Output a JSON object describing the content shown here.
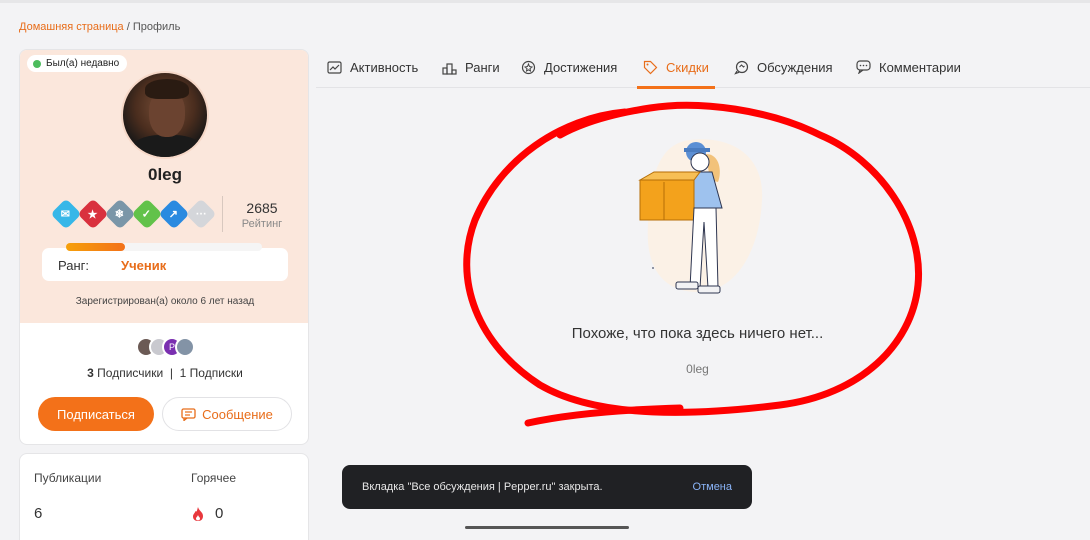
{
  "breadcrumb": {
    "home": "Домашняя страница",
    "separator": " / ",
    "current": "Профиль"
  },
  "profile": {
    "status": "Был(а) недавно",
    "username": "0leg",
    "rating_value": "2685",
    "rating_label": "Рейтинг",
    "rank_label": "Ранг:",
    "rank_value": "Ученик",
    "rank_progress": 0.3,
    "registered": "Зарегистрирован(а) около 6 лет назад",
    "followers_count": "3",
    "followers_label": "Подписчики",
    "following_sep": "|",
    "following_count": "1",
    "following_label": "Подписки",
    "subscribe_label": "Подписаться",
    "message_label": "Сообщение",
    "badges": [
      "chat-badge-icon",
      "ribbon-badge-icon",
      "snowflake-badge-icon",
      "check-badge-icon",
      "rocket-badge-icon",
      "more-badge-icon"
    ]
  },
  "stats": {
    "posts_label": "Публикации",
    "posts_value": "6",
    "hot_label": "Горячее",
    "hot_value": "0"
  },
  "tabs": [
    {
      "label": "Активность",
      "icon": "activity-icon"
    },
    {
      "label": "Ранги",
      "icon": "podium-icon"
    },
    {
      "label": "Достижения",
      "icon": "achievement-icon"
    },
    {
      "label": "Скидки",
      "icon": "tag-icon",
      "active": true
    },
    {
      "label": "Обсуждения",
      "icon": "discussion-icon"
    },
    {
      "label": "Комментарии",
      "icon": "comment-icon"
    }
  ],
  "empty": {
    "title": "Похоже, что пока здесь ничего нет...",
    "subtitle": "0leg"
  },
  "toast": {
    "message": "Вкладка \"Все обсуждения | Pepper.ru\" закрыта.",
    "action": "Отмена"
  },
  "colors": {
    "accent": "#f37119",
    "annotation": "#ff0000",
    "toast_bg": "#202124"
  }
}
